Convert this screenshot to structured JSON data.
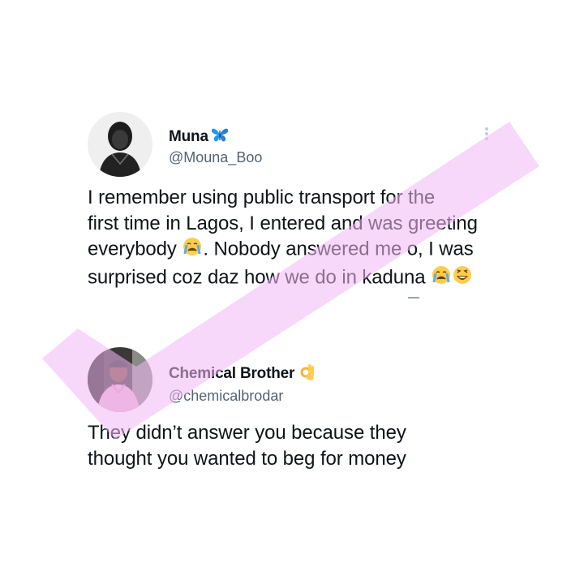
{
  "tweets": [
    {
      "display_name": "Muna",
      "name_icon": "butterfly-icon",
      "handle": "@Mouna_Boo",
      "text_lines": [
        "I remember using public transport for the",
        "first time in Lagos, I entered and was greeting",
        "everybody",
        ". Nobody answered me o, I was",
        "surprised coz daz how we do in kaduna"
      ],
      "emojis": [
        "crying-face-icon",
        "crying-face-icon",
        "laughing-face-icon"
      ],
      "menu_icon": "more-vertical-icon"
    },
    {
      "display_name": "Chemical Brother",
      "name_icon": "ok-hand-icon",
      "handle": "@chemicalbrodar",
      "text_lines": [
        "They didn’t answer you because they",
        "thought you wanted to beg for money"
      ]
    }
  ],
  "colors": {
    "text": "#0f1419",
    "handle": "#536471",
    "watermark": "#f2b8f5",
    "butterfly": "#1d9bf0"
  }
}
